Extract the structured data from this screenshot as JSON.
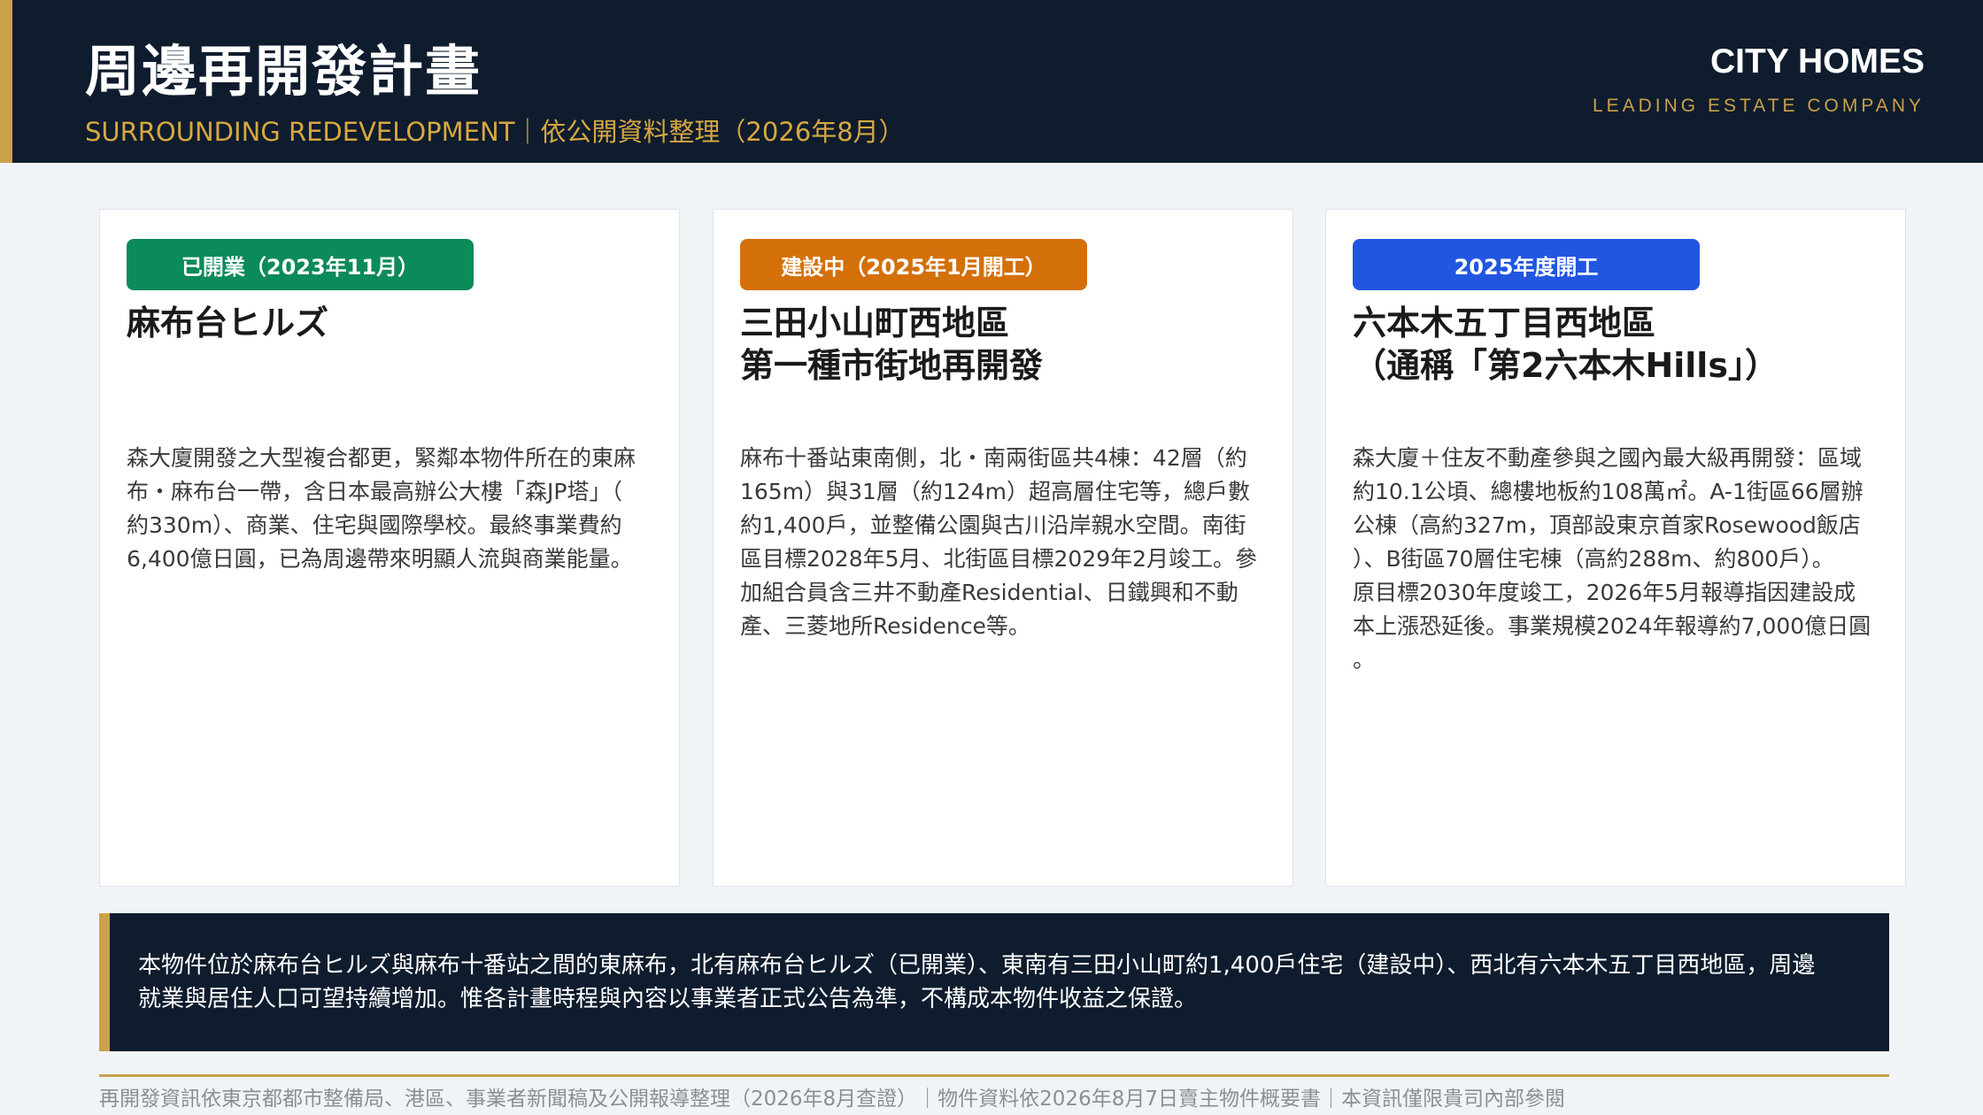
{
  "header": {
    "title": "周邊再開發計畫",
    "subtitle": "SURROUNDING REDEVELOPMENT｜依公開資料整理（2026年8月）",
    "brand": "CITY HOMES",
    "tagline": "LEADING ESTATE COMPANY"
  },
  "colors": {
    "navy": "#0f1c2e",
    "gold": "#c9a14a",
    "opened": "#0b8a5a",
    "construction": "#d4700a",
    "start": "#2256e0"
  },
  "cards": [
    {
      "badge": "已開業（2023年11月）",
      "title_line1": "麻布台ヒルズ",
      "title_line2": "",
      "body_lines": [
        "森大廈開發之大型複合都更，緊鄰本物件所在的東麻",
        "布・麻布台一帶，含日本最高辦公大樓「森JP塔」（",
        "約330m）、商業、住宅與國際學校。最終事業費約",
        "6,400億日圓，已為周邊帶來明顯人流與商業能量。"
      ]
    },
    {
      "badge": "建設中（2025年1月開工）",
      "title_line1": "三田小山町西地區",
      "title_line2": "第一種市街地再開發",
      "body_lines": [
        "麻布十番站東南側，北・南兩街區共4棟：42層（約",
        "165m）與31層（約124m）超高層住宅等，總戶數",
        "約1,400戶，並整備公園與古川沿岸親水空間。南街",
        "區目標2028年5月、北街區目標2029年2月竣工。參",
        "加組合員含三井不動產Residential、日鐵興和不動",
        "產、三菱地所Residence等。"
      ]
    },
    {
      "badge": "2025年度開工",
      "title_line1": "六本木五丁目西地區",
      "title_line2": "（通稱「第2六本木Hills」）",
      "body_lines": [
        "森大廈＋住友不動產參與之國內最大級再開發：區域",
        "約10.1公頃、總樓地板約108萬㎡。A-1街區66層辦",
        "公棟（高約327m，頂部設東京首家Rosewood飯店",
        "）、B街區70層住宅棟（高約288m、約800戶）。",
        "原目標2030年度竣工，2026年5月報導指因建設成",
        "本上漲恐延後。事業規模2024年報導約7,000億日圓",
        "。"
      ]
    }
  ],
  "note": {
    "line1": "本物件位於麻布台ヒルズ與麻布十番站之間的東麻布，北有麻布台ヒルズ（已開業）、東南有三田小山町約1,400戶住宅（建設中）、西北有六本木五丁目西地區，周邊",
    "line2": "就業與居住人口可望持續增加。惟各計畫時程與內容以事業者正式公告為準，不構成本物件收益之保證。"
  },
  "footer": "再開發資訊依東京都都市整備局、港區、事業者新聞稿及公開報導整理（2026年8月查證）｜物件資料依2026年8月7日賣主物件概要書｜本資訊僅限貴司內部參閱"
}
